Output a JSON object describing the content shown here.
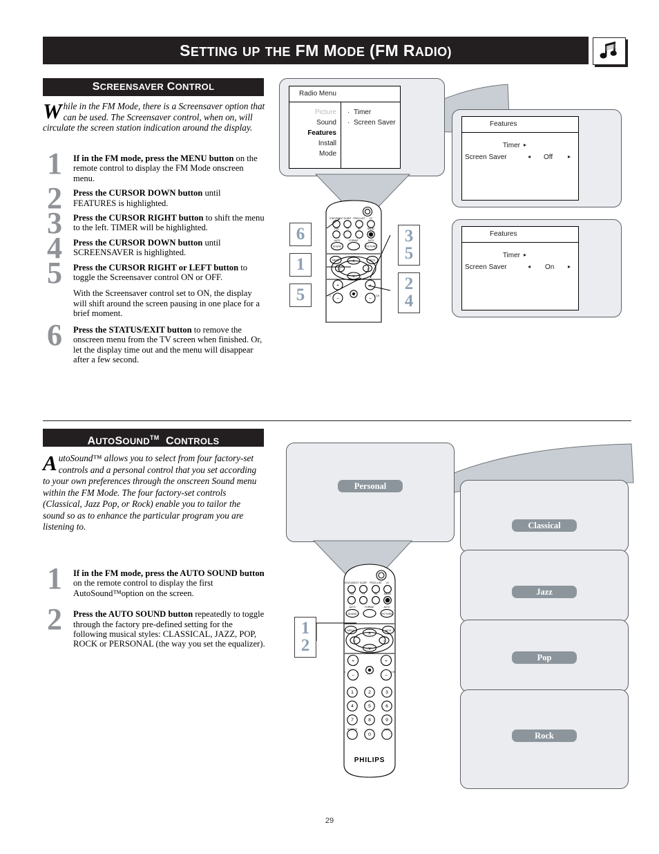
{
  "header": {
    "title_parts": [
      {
        "t": "S",
        "big": true
      },
      {
        "t": "ETTING",
        "big": false
      },
      {
        "t": " ",
        "big": false
      },
      {
        "t": "UP",
        "big": false
      },
      {
        "t": " ",
        "big": false
      },
      {
        "t": "THE",
        "big": false
      },
      {
        "t": " ",
        "big": false
      },
      {
        "t": "FM",
        "big": true
      },
      {
        "t": " ",
        "big": false
      },
      {
        "t": "M",
        "big": true
      },
      {
        "t": "ODE",
        "big": false
      },
      {
        "t": " (",
        "big": true
      },
      {
        "t": "FM",
        "big": true
      },
      {
        "t": " ",
        "big": false
      },
      {
        "t": "R",
        "big": true
      },
      {
        "t": "ADIO",
        "big": false
      },
      {
        "t": ")",
        "big": true
      }
    ],
    "title": "SETTING UP THE FM MODE (FM RADIO)",
    "icon": "music-note-icon"
  },
  "page_number": "29",
  "section1": {
    "heading": "SCREENSAVER CONTROL",
    "heading_caps": "S",
    "intro_dropcap": "W",
    "intro": "hile in the FM Mode, there is a Screensaver option that can be used. The Screensaver control, when on, will circulate the screen station indication around the display.",
    "steps": [
      {
        "num": "1",
        "bold": "If in the FM mode, press the MENU button",
        "rest": " on the remote control to display the FM Mode onscreen menu."
      },
      {
        "num": "2",
        "bold": "Press the CURSOR DOWN button",
        "rest": " until FEATURES is highlighted."
      },
      {
        "num": "3",
        "bold": "Press the CURSOR RIGHT button",
        "rest": " to shift the menu to the left. TIMER will be highlighted."
      },
      {
        "num": "4",
        "bold": "Press the CURSOR DOWN button",
        "rest": " until SCREENSAVER is highlighted."
      },
      {
        "num": "5",
        "bold": "Press the CURSOR RIGHT or LEFT button",
        "rest": " to toggle the Screensaver control ON or OFF."
      }
    ],
    "note": "With the Screensaver control set to ON, the display will shift around the screen pausing in one place for a brief moment.",
    "step6": {
      "num": "6",
      "bold": "Press the STATUS/EXIT button",
      "rest": " to remove the onscreen menu from the TV screen when finished. Or, let the display time out and the menu will disappear after a few second."
    }
  },
  "radio_menu": {
    "title": "Radio Menu",
    "left_items": [
      {
        "label": "Picture",
        "state": "dim"
      },
      {
        "label": "Sound",
        "state": "normal"
      },
      {
        "label": "Features",
        "state": "bold"
      },
      {
        "label": "Install",
        "state": "normal"
      },
      {
        "label": "Mode",
        "state": "normal"
      }
    ],
    "right_items": [
      "Timer",
      "Screen Saver"
    ],
    "bullet": "·"
  },
  "features_panel_off": {
    "title": "Features",
    "row1_label": "Timer",
    "row1_arrow": "▸",
    "row2_label": "Screen Saver",
    "row2_left_arrow": "◂",
    "row2_value": "Off",
    "row2_right_arrow": "▸"
  },
  "features_panel_on": {
    "title": "Features",
    "row1_label": "Timer",
    "row1_arrow": "▸",
    "row2_label": "Screen Saver",
    "row2_left_arrow": "◂",
    "row2_value": "On",
    "row2_right_arrow": "▸"
  },
  "callout_tags_top": {
    "left_6": "6",
    "left_1": "1",
    "left_5": "5",
    "right_3": "3",
    "right_5": "5",
    "right_2": "2",
    "right_4": "4"
  },
  "callout_tags_bottom": {
    "t1": "1",
    "t2": "2"
  },
  "remote": {
    "brand": "PHILIPS",
    "power": "power-icon",
    "row1": [
      {
        "label": "STATUS/EXIT"
      },
      {
        "label": "SLEEP"
      },
      {
        "label": "PROG. LIST"
      },
      {
        "label": "CC"
      }
    ],
    "row2": [
      {
        "label": "VGA"
      },
      {
        "label": "TV"
      },
      {
        "label": "HD"
      },
      {
        "label": "RADIO"
      }
    ],
    "row3": [
      {
        "label": "AUTO",
        "sub": "SOUND"
      },
      {
        "label": "FORMAT",
        "sub": ""
      },
      {
        "label": "AUTO",
        "sub": "PICTURE"
      }
    ],
    "menu": "MENU",
    "ach": "A/CH",
    "cursor_up": "∧",
    "cursor_down": "∨",
    "cursor_left": "‹",
    "cursor_right": "›",
    "vol_label": "◁",
    "ch_label": "CH",
    "mute": "mute-icon",
    "plus": "+",
    "minus": "−",
    "digits": [
      "1",
      "2",
      "3",
      "4",
      "5",
      "6",
      "7",
      "8",
      "9",
      "0"
    ],
    "source": "SOURCE",
    "surf": "SURF"
  },
  "section2": {
    "heading_a": "A",
    "heading_utosound": "UTO",
    "heading_sound": "S",
    "heading_sound_rest": "OUND",
    "heading_tm": "TM",
    "heading_c": "C",
    "heading_controls": "ONTROLS",
    "heading": "AUTOSOUND™ CONTROLS",
    "intro_dropcap": "A",
    "intro": "utoSound™ allows you to select from four factory-set controls and a personal control that you set according to your own preferences through the onscreen Sound menu within the FM Mode. The four factory-set controls (Classical, Jazz Pop, or Rock) enable you to tailor the sound so as to enhance the particular program you are listening to.",
    "steps": [
      {
        "num": "1",
        "bold": "If in the FM mode, press the AUTO SOUND button",
        "rest": " on the remote control to display the first AutoSound™option on the screen."
      },
      {
        "num": "2",
        "bold": "Press the AUTO SOUND button",
        "rest": " repeatedly to toggle through the factory pre-defined setting for the following musical styles: CLASSICAL, JAZZ, POP, ROCK or PERSONAL (the way you set the equalizer)."
      }
    ]
  },
  "autosound_panels": [
    {
      "label": "Personal"
    },
    {
      "label": "Classical"
    },
    {
      "label": "Jazz"
    },
    {
      "label": "Pop"
    },
    {
      "label": "Rock"
    }
  ],
  "colors": {
    "header_bg": "#231f20",
    "bubble_bg": "#eaecef",
    "bubble_border": "#5a5f63",
    "wedge": "#c9ced4",
    "step_number": "#8f9296",
    "tag_number": "#8d9fb3",
    "chip_bg": "#8d959c"
  }
}
